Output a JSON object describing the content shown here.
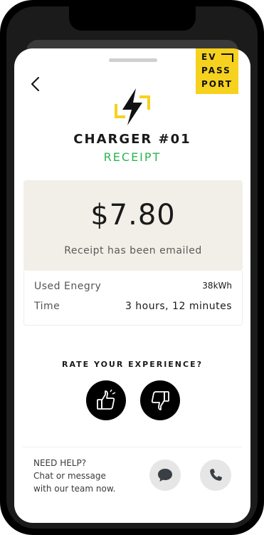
{
  "logo": {
    "line1": "EV",
    "line2": "PASS",
    "line3": "PORT",
    "color": "#f6d21f"
  },
  "header": {
    "title": "CHARGER #01",
    "subtitle": "RECEIPT"
  },
  "receipt": {
    "amount": "$7.80",
    "email_status": "Receipt has been emailed",
    "rows": [
      {
        "label": "Used Enegry",
        "value": "38kWh"
      },
      {
        "label": "Time",
        "value": "3 hours, 12 minutes"
      }
    ]
  },
  "rating": {
    "prompt": "RATE YOUR EXPERIENCE?"
  },
  "help": {
    "line1": "NEED HELP?",
    "line2": "Chat or message",
    "line3": "with our team now."
  },
  "icons": [
    "back-icon",
    "lightning-bolt-icon",
    "thumbs-up-icon",
    "thumbs-down-icon",
    "chat-bubble-icon",
    "phone-icon"
  ],
  "colors": {
    "accent_green": "#2bb54d",
    "brand_yellow": "#f6d21f",
    "amount_box": "#f1efe8"
  }
}
